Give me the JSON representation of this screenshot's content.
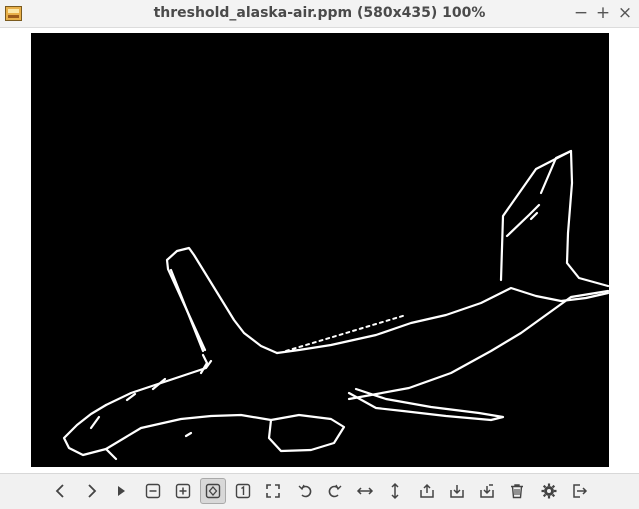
{
  "window": {
    "title": "threshold_alaska-air.ppm (580x435) 100%",
    "controls": {
      "minimize": "−",
      "maximize": "+",
      "close": "×"
    }
  },
  "image_view": {
    "background": "#000000",
    "edges": "#ffffff"
  },
  "toolbar": {
    "buttons": [
      {
        "name": "previous-icon"
      },
      {
        "name": "next-icon"
      },
      {
        "name": "slideshow-icon"
      },
      {
        "name": "zoom-out-icon"
      },
      {
        "name": "zoom-in-icon"
      },
      {
        "name": "zoom-fit-icon",
        "active": true
      },
      {
        "name": "zoom-1to1-icon"
      },
      {
        "name": "fullscreen-icon"
      },
      {
        "name": "rotate-left-icon"
      },
      {
        "name": "rotate-right-icon"
      },
      {
        "name": "flip-horizontal-icon"
      },
      {
        "name": "flip-vertical-icon"
      },
      {
        "name": "open-icon"
      },
      {
        "name": "save-icon"
      },
      {
        "name": "save-as-icon"
      },
      {
        "name": "delete-icon"
      },
      {
        "name": "settings-icon"
      },
      {
        "name": "exit-icon"
      }
    ]
  }
}
